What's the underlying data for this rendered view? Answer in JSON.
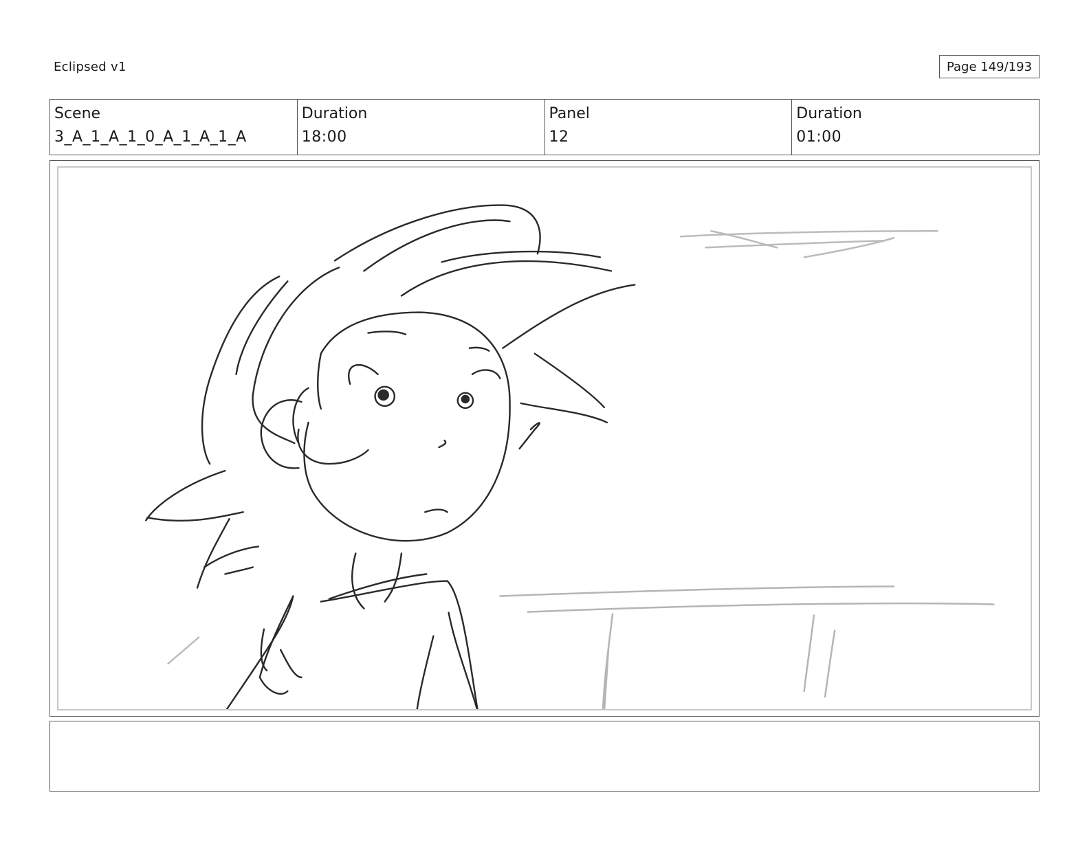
{
  "header": {
    "project_title": "Eclipsed v1",
    "page_label": "Page 149/193"
  },
  "info": {
    "scene_label": "Scene",
    "scene_value": "3_A_1_A_1_0_A_1_A_1_A",
    "scene_duration_label": "Duration",
    "scene_duration_value": "18:00",
    "panel_label": "Panel",
    "panel_value": "12",
    "panel_duration_label": "Duration",
    "panel_duration_value": "01:00"
  },
  "notes": {
    "text": ""
  }
}
